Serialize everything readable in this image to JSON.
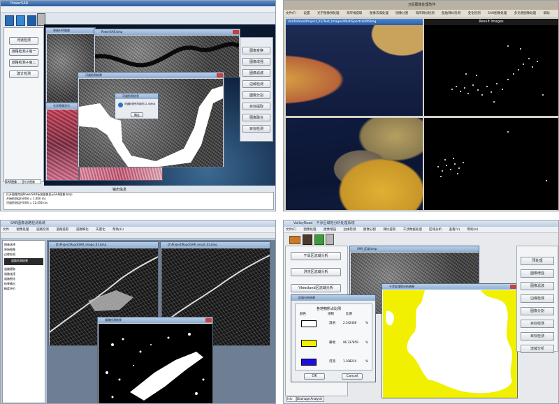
{
  "q1": {
    "title": "PowerSAR",
    "buttons": [
      "河道检测",
      "道路检测子窗一",
      "道路检测子窗二",
      "建计检测"
    ],
    "right_buttons": [
      "图像变换",
      "图像增强",
      "图像滤波",
      "边缘检测",
      "图像分割",
      "目标提取",
      "图像融合",
      "目标检测"
    ],
    "img_win1_title": "原始SAR图像",
    "img_win2_title": "PowerSAR.bmp",
    "result_win_title": "河道检测结果",
    "dialog_title": "河道检测信息",
    "dialog_text": "河道检测完毕用时12.4560s",
    "dialog_ok": "确定",
    "optical_win_title": "光学图像显示",
    "panel_tabs": [
      "SAR图像",
      "光学图像"
    ],
    "bottom_label": "输出信息",
    "log_lines": [
      "打开图像完成PowerSAR标准图像显示SAR图像.bmp",
      "开始检测运行时间 = 1.000 ms",
      "河道检测运行时间 = 12.456 ms"
    ]
  },
  "q2": {
    "app_title": "卫星图像处理软件",
    "menu": [
      "文件(F)",
      "设置",
      "光学图像预处理",
      "海岸线提取",
      "图像去噪处理",
      "图像分割",
      "海岸目标检测",
      "船舶目标检测",
      "变化检测",
      "SAR图像处理",
      "多光谱图像处理",
      "帮助"
    ],
    "path": "/mnt/share/Project_01/Test_Images/MultiSpectral/MSImg",
    "result_title": "Result Images"
  },
  "q3": {
    "title": "SAR图像道路检测系统",
    "menu": [
      "文件",
      "图像处理",
      "道路检测",
      "道路提取",
      "道路细化",
      "矢量化",
      "帮助(H)"
    ],
    "left_items": [
      "图像选择",
      "原始图像",
      "边缘检测",
      "道路提取",
      "道路连接",
      "道路细化",
      "结果输出",
      "精度评价"
    ],
    "left_highlight": "道路检测结果",
    "img1_title": "D:\\Project\\Road\\SAR_image_01.bmp",
    "img2_title": "D:\\Project\\Road\\SAR_result_01.bmp",
    "result_title": "道路检测结果"
  },
  "q4": {
    "title": "ValleyRoad - 干涉区域地分析处理系统",
    "menu": [
      "文件(F)",
      "图像处理",
      "图像增强",
      "边缘检测",
      "图像分割",
      "目标提取",
      "干涉数据处理",
      "区域分析",
      "查看(V)",
      "帮助(H)"
    ],
    "analysis_buttons": [
      "干旱区流域分析",
      "洪涝区流域分析",
      "Vleesland区流域分析"
    ],
    "img_win_title": "SAR_区域.bmp",
    "result_title": "干涉区域地分析结果",
    "stats_title": "区域分析结果",
    "stats_header_title": "各地物所占比例",
    "stats_cols": [
      "颜色",
      "地物",
      "比例"
    ],
    "stats_rows": [
      {
        "color": "#ffffff",
        "name": "湿地",
        "value": "2.342408",
        "unit": "%"
      },
      {
        "color": "#f0f000",
        "name": "耕地",
        "value": "96.337859",
        "unit": "%"
      },
      {
        "color": "#1a10e0",
        "name": "河流",
        "value": "1.308224",
        "unit": "%"
      }
    ],
    "ok": "OK",
    "cancel": "Cancel",
    "right_buttons": [
      "预处理",
      "图像增强",
      "图像滤波",
      "边缘检测",
      "图像分割",
      "目标检测",
      "目标检测",
      "流域分析"
    ],
    "bottom_tabs": [
      "Info",
      "Drainage Analysis"
    ]
  }
}
